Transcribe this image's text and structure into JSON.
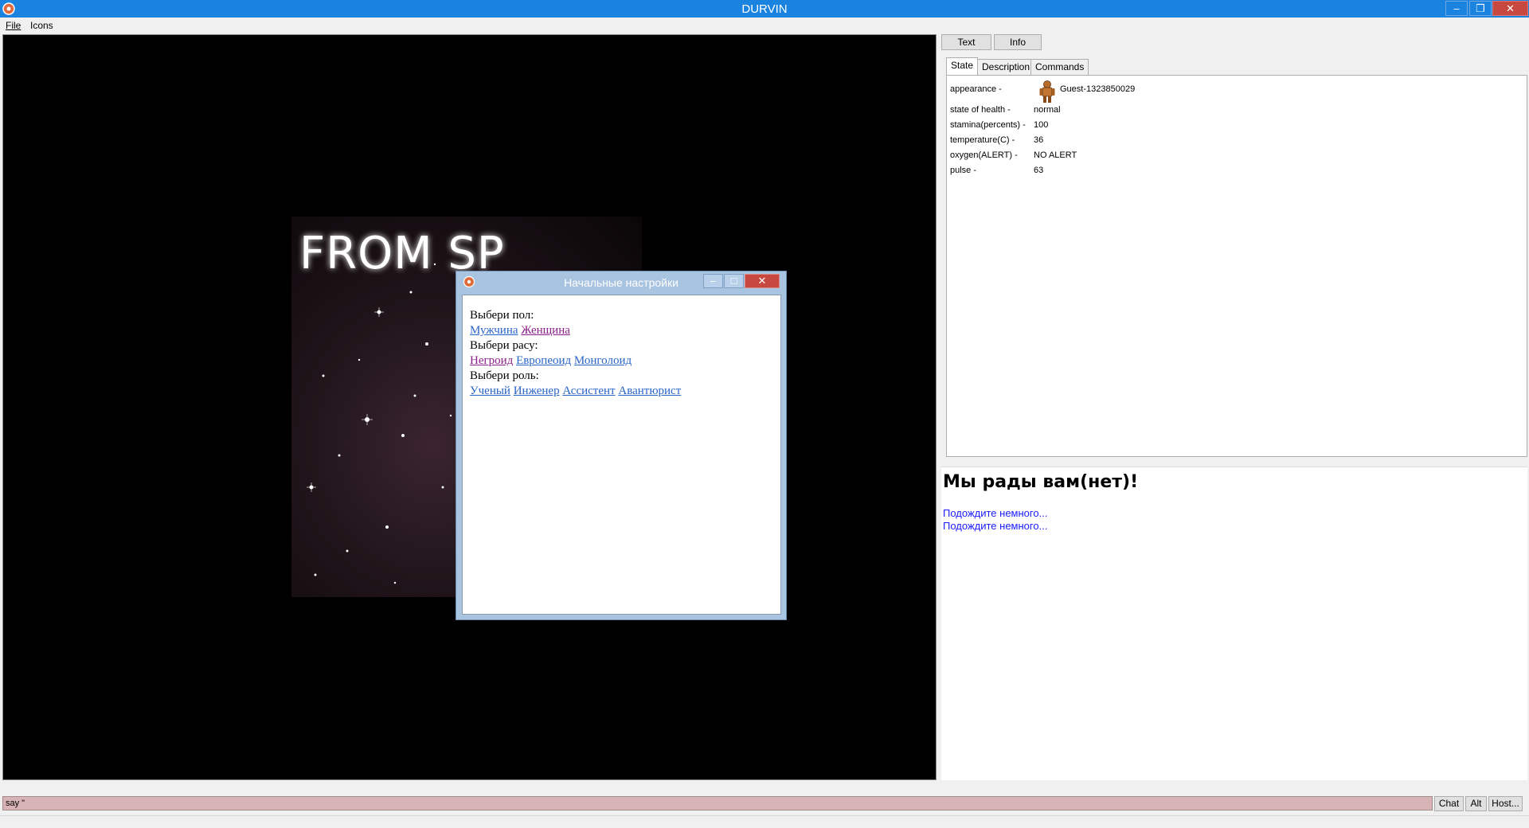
{
  "window": {
    "title": "DURVIN",
    "minimize_glyph": "–",
    "restore_glyph": "❐",
    "close_glyph": "✕"
  },
  "menu": {
    "items": [
      "File",
      "Icons"
    ]
  },
  "game": {
    "splash_text": "FROM SP"
  },
  "dialog": {
    "title": "Начальные настройки",
    "minimize_glyph": "–",
    "maximize_glyph": "□",
    "close_glyph": "✕",
    "gender_prompt": "Выбери пол:",
    "gender_options": [
      "Мужчина",
      "Женщина"
    ],
    "race_prompt": "Выбери расу:",
    "race_options": [
      "Негроид",
      "Европеоид",
      "Монголоид"
    ],
    "role_prompt": "Выбери роль:",
    "role_options": [
      "Ученый",
      "Инженер",
      "Ассистент",
      "Авантюрист"
    ]
  },
  "panel": {
    "buttons": [
      "Text",
      "Info"
    ],
    "tabs": [
      "State",
      "Description",
      "Commands"
    ],
    "active_tab": "State",
    "stats": [
      {
        "label": "appearance -",
        "value": "Guest-1323850029"
      },
      {
        "label": "state of health -",
        "value": "normal"
      },
      {
        "label": "stamina(percents) -",
        "value": "100"
      },
      {
        "label": "temperature(C) -",
        "value": "36"
      },
      {
        "label": "oxygen(ALERT) -",
        "value": "NO ALERT"
      },
      {
        "label": "pulse -",
        "value": "63"
      }
    ]
  },
  "chat": {
    "title": "Мы рады вам(нет)!",
    "lines": [
      "Подождите немного...",
      "Подождите немного..."
    ]
  },
  "input": {
    "value": "say \"",
    "buttons": [
      "Chat",
      "Alt",
      "Host..."
    ]
  },
  "colors": {
    "titlebar": "#1a83e0",
    "input_bg": "#d9b4b6",
    "link": "#2a64c7",
    "visited_link": "#8a1f8a",
    "chat_text": "#1a1aff"
  }
}
